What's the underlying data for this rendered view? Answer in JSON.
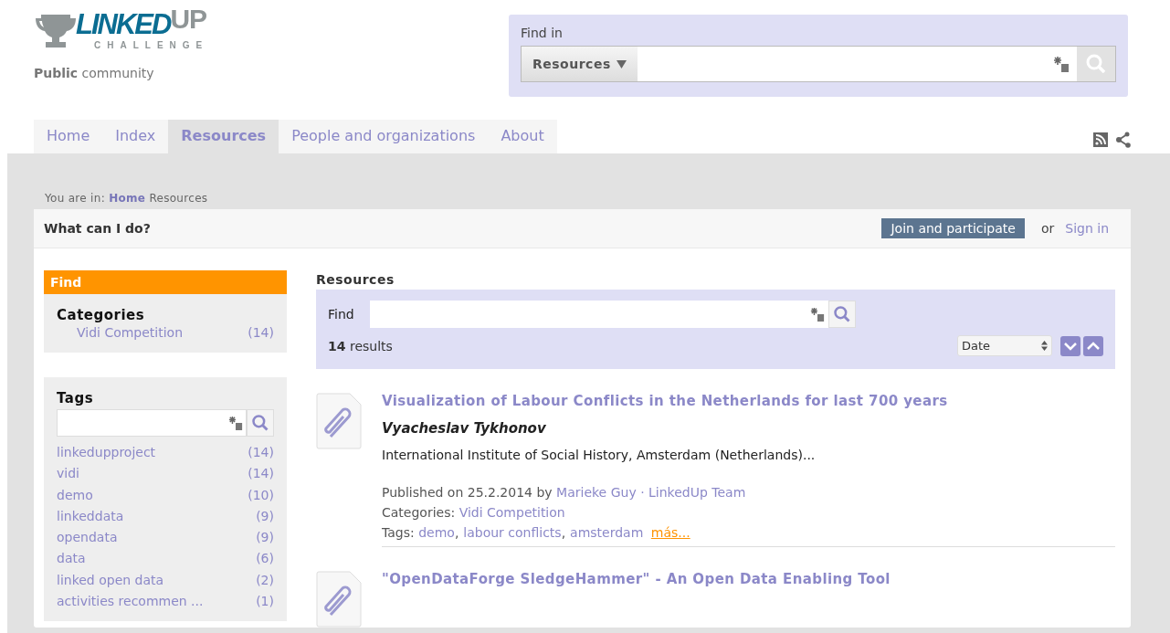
{
  "logo": {
    "word": "LINKED",
    "accent": "UP",
    "subtitle": "CHALLENGE"
  },
  "community": {
    "strong": "Public",
    "rest": "community"
  },
  "header_search": {
    "label": "Find in",
    "scope": "Resources"
  },
  "tabs": [
    {
      "label": "Home",
      "selected": false
    },
    {
      "label": "Index",
      "selected": false
    },
    {
      "label": "Resources",
      "selected": true
    },
    {
      "label": "People and organizations",
      "selected": false
    },
    {
      "label": "About",
      "selected": false
    }
  ],
  "breadcrumb": {
    "prefix": "You are in:",
    "link": "Home",
    "current": "Resources"
  },
  "action_bar": {
    "title": "What can I do?",
    "join": "Join and participate",
    "or": "or",
    "sign_in": "Sign in"
  },
  "sidebar": {
    "find_title": "Find",
    "categories_title": "Categories",
    "categories": [
      {
        "name": "Vidi Competition",
        "count": "(14)"
      }
    ],
    "tags_title": "Tags",
    "tags": [
      {
        "name": "linkedupproject",
        "count": "(14)"
      },
      {
        "name": "vidi",
        "count": "(14)"
      },
      {
        "name": "demo",
        "count": "(10)"
      },
      {
        "name": "linkeddata",
        "count": "(9)"
      },
      {
        "name": "opendata",
        "count": "(9)"
      },
      {
        "name": "data",
        "count": "(6)"
      },
      {
        "name": "linked open data",
        "count": "(2)"
      },
      {
        "name": "activities recommen ...",
        "count": "(1)"
      }
    ]
  },
  "resources": {
    "title": "Resources",
    "find_label": "Find",
    "results_count": "14",
    "results_label": "results",
    "sort": "Date",
    "items": [
      {
        "title": "Visualization of Labour Conflicts in the Netherlands for last 700 years",
        "author": "Vyacheslav Tykhonov",
        "summary": "International Institute of Social History, Amsterdam (Netherlands)...",
        "published": "Published on 25.2.2014 by",
        "publisher": "Marieke Guy",
        "separator": "·",
        "team": "LinkedUp Team",
        "categories_label": "Categories:",
        "categories": [
          "Vidi Competition"
        ],
        "tags_label": "Tags:",
        "tags": [
          "demo",
          "labour conflicts",
          "amsterdam"
        ],
        "tag_separator": ",",
        "more": "más..."
      },
      {
        "title": "\"OpenDataForge SledgeHammer\" - An Open Data Enabling Tool"
      }
    ]
  }
}
